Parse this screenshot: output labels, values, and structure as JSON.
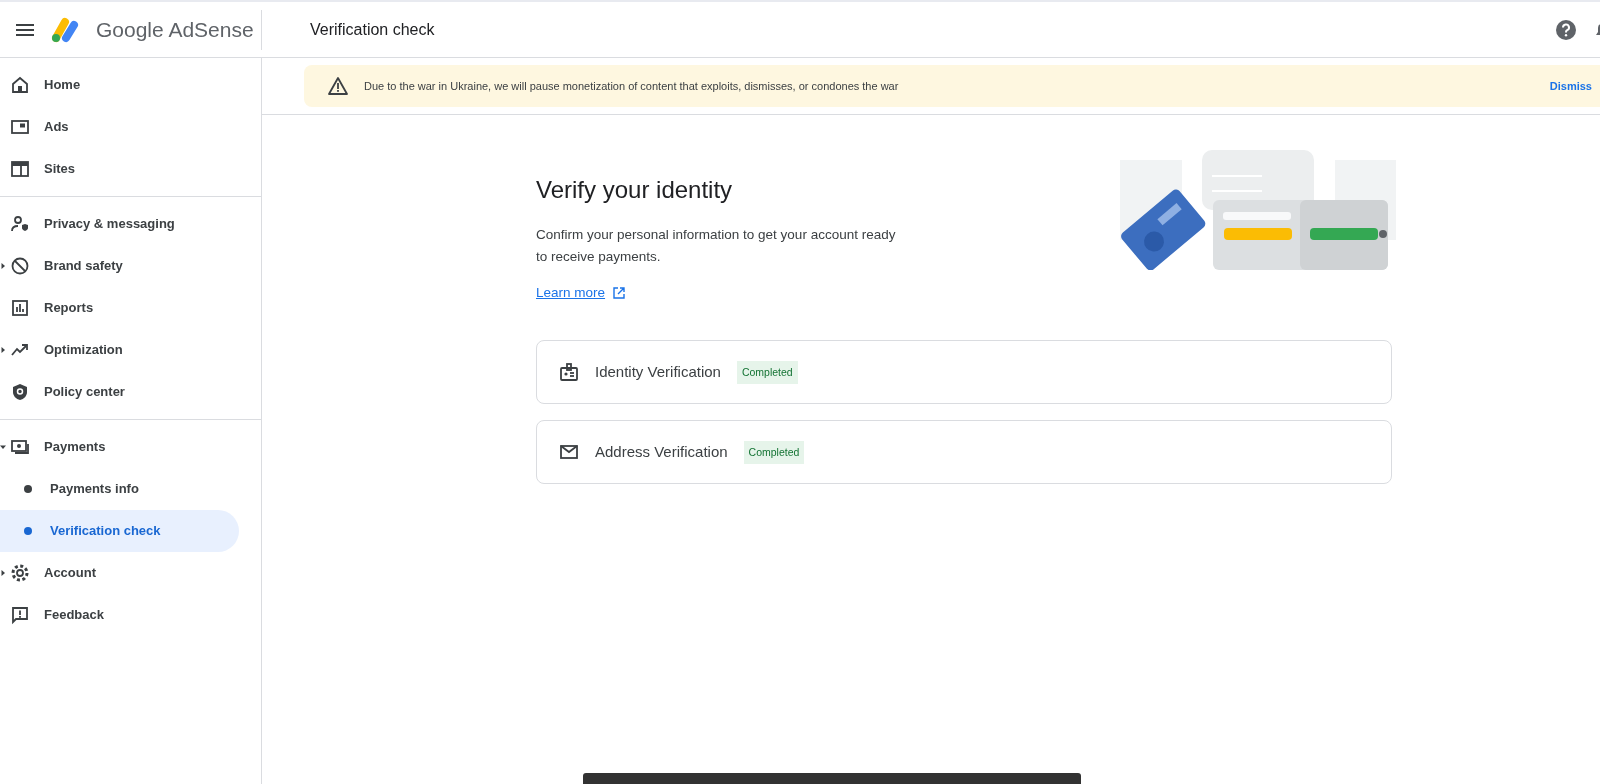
{
  "header": {
    "product": "Google AdSense",
    "page_title": "Verification check"
  },
  "sidebar": {
    "sections": [
      [
        {
          "kind": "link",
          "label": "Home",
          "selected": false
        },
        {
          "kind": "link",
          "label": "Ads",
          "selected": false
        },
        {
          "kind": "link",
          "label": "Sites",
          "selected": false
        }
      ],
      [
        {
          "kind": "link",
          "label": "Privacy & messaging",
          "selected": false
        },
        {
          "kind": "group",
          "label": "Brand safety",
          "expanded": false,
          "selected": false
        },
        {
          "kind": "link",
          "label": "Reports",
          "selected": false
        },
        {
          "kind": "group",
          "label": "Optimization",
          "expanded": false,
          "selected": false
        },
        {
          "kind": "link",
          "label": "Policy center",
          "selected": false
        }
      ],
      [
        {
          "kind": "group",
          "label": "Payments",
          "expanded": true,
          "selected": false,
          "children": [
            {
              "label": "Payments info",
              "selected": false
            },
            {
              "label": "Verification check",
              "selected": true
            }
          ]
        },
        {
          "kind": "group",
          "label": "Account",
          "expanded": false,
          "selected": false
        },
        {
          "kind": "link",
          "label": "Feedback",
          "selected": false
        }
      ]
    ]
  },
  "banner": {
    "message": "Due to the war in Ukraine, we will pause monetization of content that exploits, dismisses, or condones the war",
    "action": "Dismiss"
  },
  "main": {
    "title": "Verify your identity",
    "description": "Confirm your personal information to get your account ready to receive payments.",
    "link": "Learn more",
    "steps": [
      {
        "kind": "identity",
        "label": "Identity Verification",
        "status": "Completed"
      },
      {
        "kind": "address",
        "label": "Address Verification",
        "status": "Completed"
      }
    ]
  }
}
